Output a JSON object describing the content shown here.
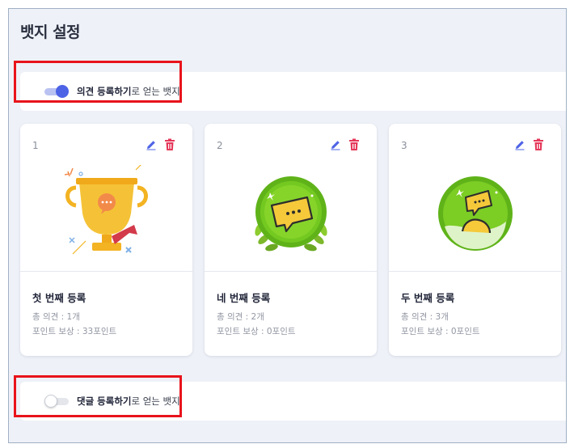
{
  "page": {
    "title": "뱃지 설정"
  },
  "sections": [
    {
      "enabled": true,
      "label_bold": "의견 등록하기",
      "label_rest": "로 얻는 뱃지"
    },
    {
      "enabled": false,
      "label_bold": "댓글 등록하기",
      "label_rest": "로 얻는 뱃지"
    }
  ],
  "cards": [
    {
      "number": "1",
      "title": "첫 번째 등록",
      "opinions": "총 의견 : 1개",
      "reward": "포인트 보상 : 33포인트",
      "badge": "trophy-badge"
    },
    {
      "number": "2",
      "title": "네 번째 등록",
      "opinions": "총 의견 : 2개",
      "reward": "포인트 보상 : 0포인트",
      "badge": "green-laurel-badge"
    },
    {
      "number": "3",
      "title": "두 번째 등록",
      "opinions": "총 의견 : 3개",
      "reward": "포인트 보상 : 0포인트",
      "badge": "green-ring-badge"
    }
  ],
  "colors": {
    "accent": "#4d63e6",
    "delete": "#e5385a",
    "highlight": "#e8131b",
    "badge_green": "#6cc31c",
    "badge_yellow": "#f5c93a"
  },
  "icons": {
    "edit": "pencil-icon",
    "delete": "trash-icon"
  }
}
